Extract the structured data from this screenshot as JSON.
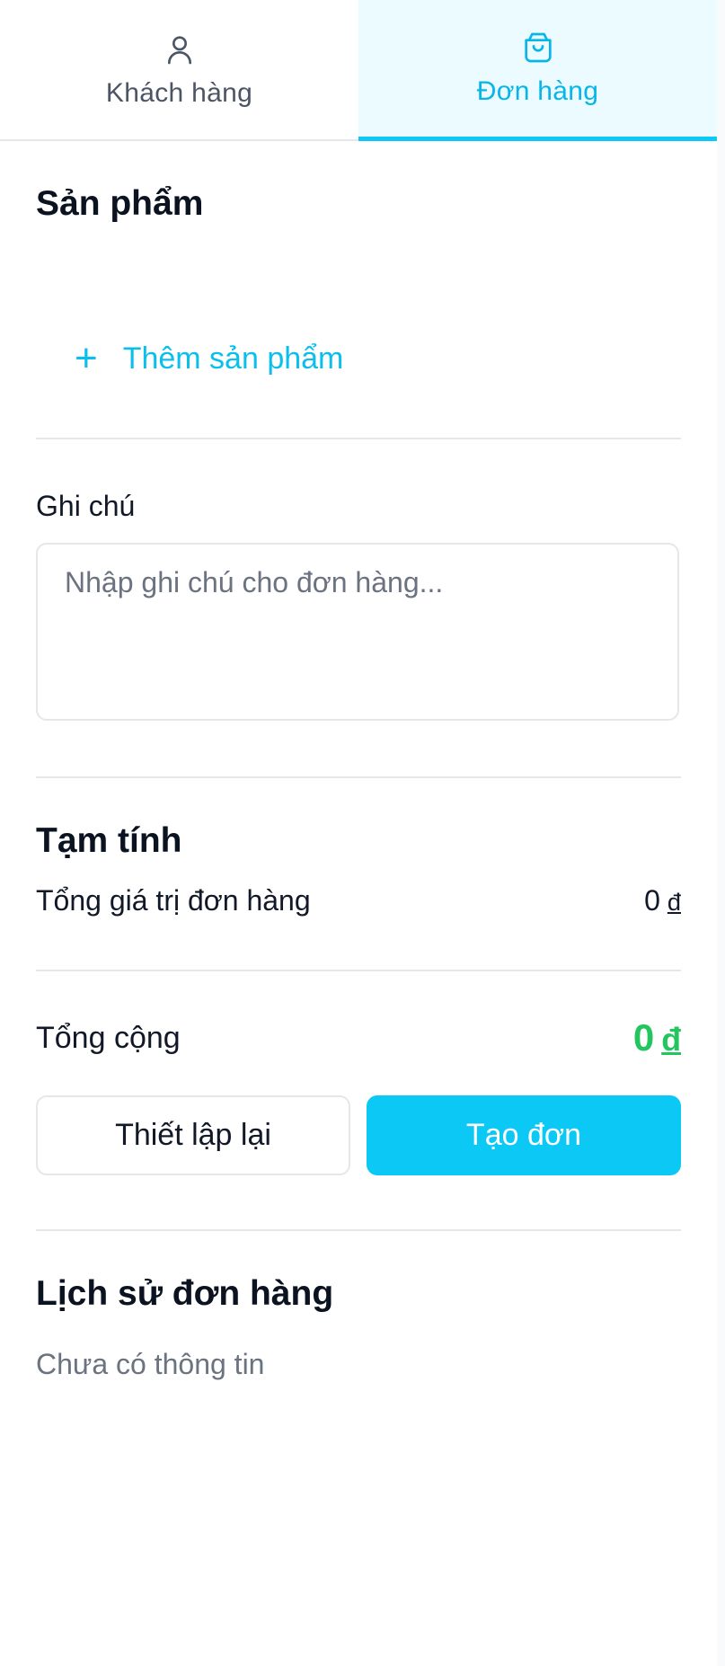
{
  "tabs": [
    {
      "label": "Khách hàng",
      "icon": "user-icon",
      "active": false
    },
    {
      "label": "Đơn hàng",
      "icon": "shopping-bag-icon",
      "active": true
    }
  ],
  "products": {
    "title": "Sản phẩm",
    "add_icon": "plus-icon",
    "add_label": "Thêm sản phẩm"
  },
  "note": {
    "label": "Ghi chú",
    "placeholder": "Nhập ghi chú cho đơn hàng...",
    "value": ""
  },
  "subtotal": {
    "title": "Tạm tính",
    "order_value_label": "Tổng giá trị đơn hàng",
    "order_value": "0",
    "currency": "đ"
  },
  "total": {
    "label": "Tổng cộng",
    "value": "0",
    "currency": "đ"
  },
  "actions": {
    "reset_label": "Thiết lập lại",
    "create_label": "Tạo đơn"
  },
  "history": {
    "title": "Lịch sử đơn hàng",
    "empty_text": "Chưa có thông tin"
  },
  "colors": {
    "accent": "#0cc8f5",
    "accent_text": "#06b6e8",
    "active_tab_bg": "#ecfbff",
    "total_green": "#22c55e",
    "muted_text": "#6b7280"
  }
}
